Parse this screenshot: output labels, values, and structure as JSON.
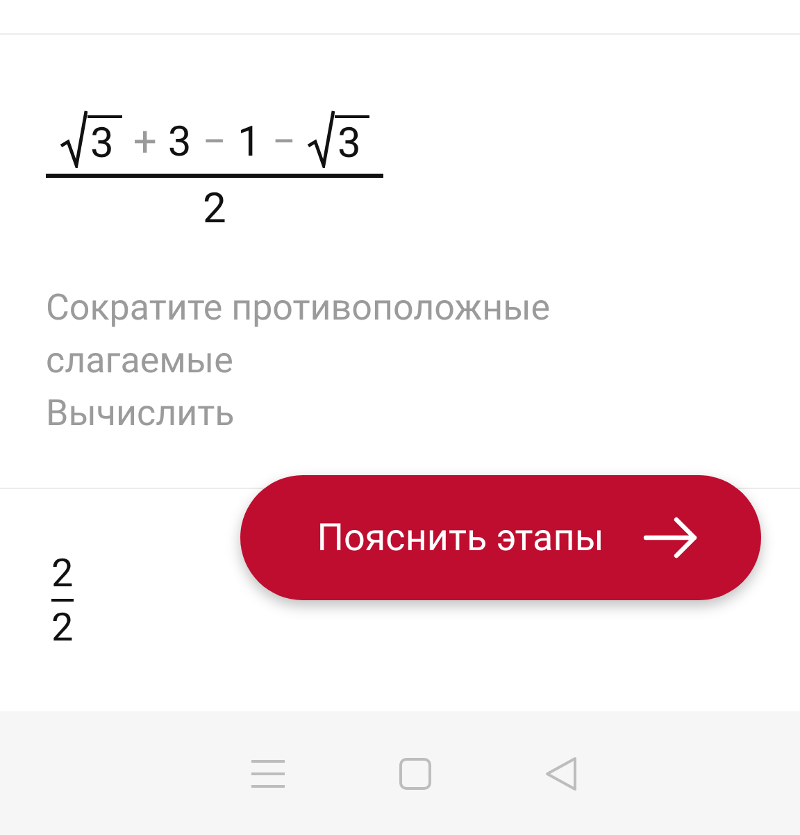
{
  "step": {
    "expression": {
      "numerator": [
        {
          "kind": "sqrt",
          "text": "3"
        },
        {
          "kind": "operator",
          "text": "+"
        },
        {
          "kind": "number",
          "text": "3"
        },
        {
          "kind": "operator",
          "text": "−"
        },
        {
          "kind": "number",
          "text": "1"
        },
        {
          "kind": "operator",
          "text": "−"
        },
        {
          "kind": "sqrt",
          "text": "3"
        }
      ],
      "denominator": "2"
    },
    "description": [
      "Сократите противоположные слагаемые",
      "Вычислить"
    ]
  },
  "result": {
    "numerator": "2",
    "denominator": "2"
  },
  "explain_button": {
    "label": "Пояснить этапы"
  }
}
